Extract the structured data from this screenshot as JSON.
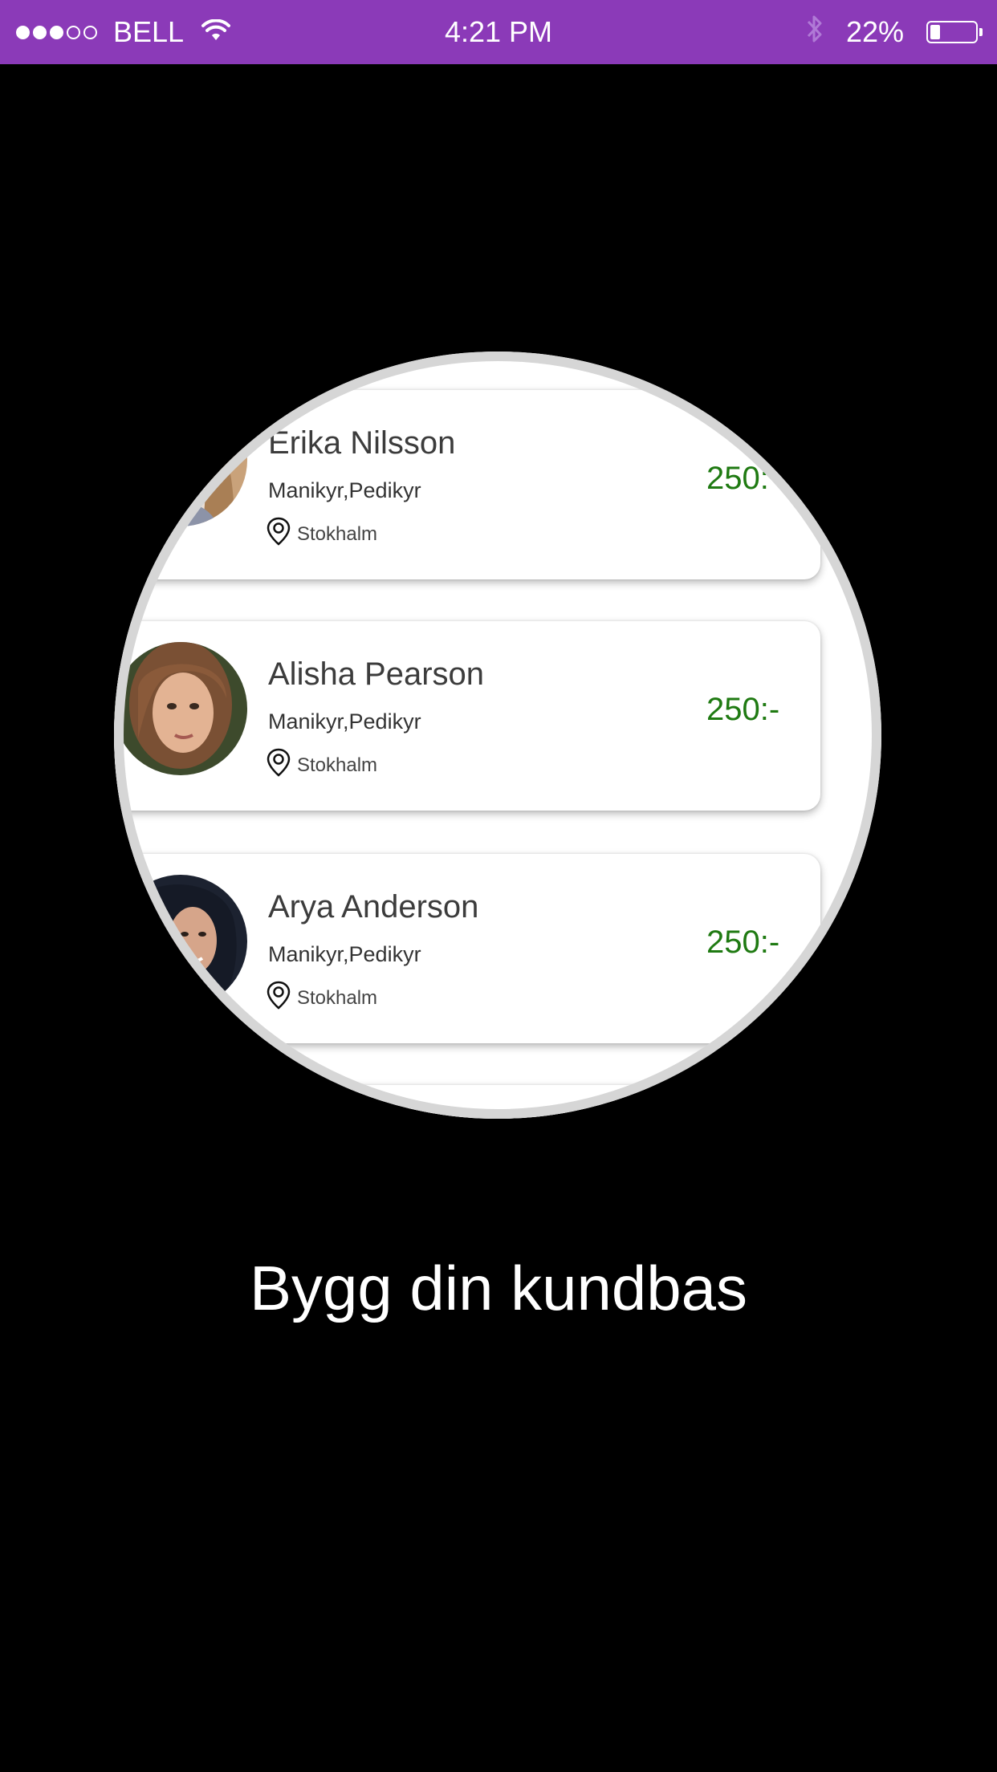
{
  "status_bar": {
    "signal_strength": 3,
    "signal_max": 5,
    "carrier": "BELL",
    "time": "4:21 PM",
    "battery_percent": "22%",
    "battery_level": 0.22,
    "bar_color": "#8B3AB8"
  },
  "list": {
    "items": [
      {
        "name": "Erika Nilsson",
        "services": "Manikyr,Pedikyr",
        "location": "Stokhalm",
        "price": "250:"
      },
      {
        "name": "Alisha Pearson",
        "services": "Manikyr,Pedikyr",
        "location": "Stokhalm",
        "price": "250:-"
      },
      {
        "name": "Arya Anderson",
        "services": "Manikyr,Pedikyr",
        "location": "Stokhalm",
        "price": "250:-"
      }
    ],
    "price_color": "#1f7a12"
  },
  "tagline": "Bygg din kundbas"
}
